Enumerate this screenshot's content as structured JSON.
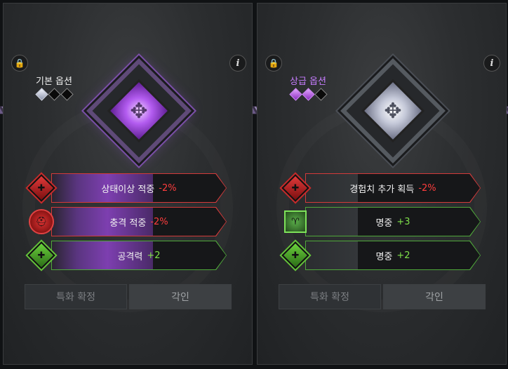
{
  "panels": [
    {
      "grade_label": "기본 옵션",
      "grade_color": "#f0f0f0",
      "grade_pips": [
        "white",
        "empty",
        "empty"
      ],
      "emblem_color": "purple",
      "options": [
        {
          "name": "상태이상 적중",
          "value": "-2%",
          "value_type": "negative",
          "frame": "red",
          "icon": "red-diamond-icon",
          "gauge_fraction": 0.58
        },
        {
          "name": "충격 적중",
          "value": "-2%",
          "value_type": "negative",
          "frame": "red",
          "icon": "red-helmet-icon",
          "gauge_fraction": 0.58
        },
        {
          "name": "공격력",
          "value": "+2",
          "value_type": "positive",
          "frame": "green",
          "icon": "green-diamond-icon",
          "gauge_fraction": 0.58
        }
      ],
      "buttons": {
        "specialize": "특화 확정",
        "engrave": "각인"
      }
    },
    {
      "grade_label": "상급 옵션",
      "grade_color": "#c77dff",
      "grade_pips": [
        "purple",
        "purple",
        "empty"
      ],
      "emblem_color": "silver",
      "options": [
        {
          "name": "경험치 추가 획득",
          "value": "-2%",
          "value_type": "negative",
          "frame": "red",
          "icon": "red-diamond-icon",
          "gauge_fraction": 0.3
        },
        {
          "name": "명중",
          "value": "+3",
          "value_type": "positive",
          "frame": "green",
          "icon": "green-ram-icon",
          "gauge_fraction": 0.3
        },
        {
          "name": "명중",
          "value": "+2",
          "value_type": "positive",
          "frame": "green",
          "icon": "green-diamond-icon",
          "gauge_fraction": 0.3
        }
      ],
      "buttons": {
        "specialize": "특화 확정",
        "engrave": "각인"
      }
    }
  ],
  "icons": {
    "lock": "lock-icon",
    "info": "info-icon",
    "info_glyph": "i",
    "lock_glyph": "🔒"
  },
  "colors": {
    "negative": "#ff3d3d",
    "positive": "#7fe04a",
    "red_frame": "#d33a3a",
    "green_frame": "#4fa83a",
    "purple_gauge": "#7d3fb0"
  }
}
